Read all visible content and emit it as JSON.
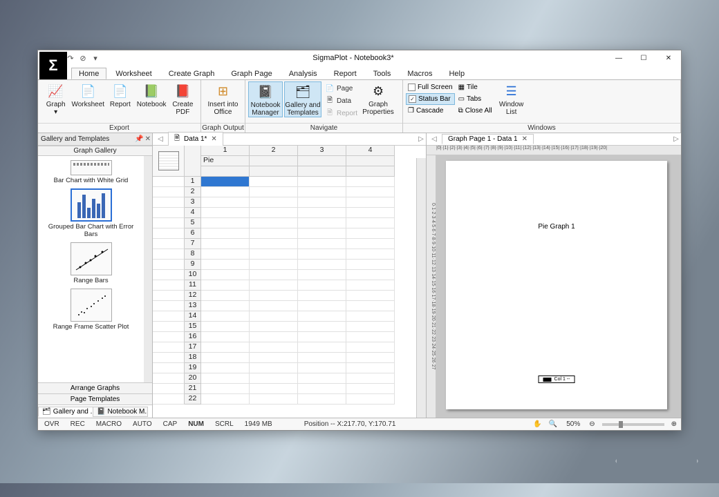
{
  "title": "SigmaPlot - Notebook3*",
  "qat": {
    "save": "💾",
    "undo": "↶",
    "redo": "↷",
    "cancel": "⊘"
  },
  "win": {
    "min": "—",
    "max": "☐",
    "close": "✕"
  },
  "menutabs": [
    "Home",
    "Worksheet",
    "Create Graph",
    "Graph Page",
    "Analysis",
    "Report",
    "Tools",
    "Macros",
    "Help"
  ],
  "active_tab": "Home",
  "ribbon": {
    "export": {
      "label": "Export",
      "graph": "Graph",
      "worksheet": "Worksheet",
      "report": "Report",
      "notebook": "Notebook",
      "create_pdf": "Create\nPDF"
    },
    "graph_output": {
      "label": "Graph Output",
      "insert_office": "Insert into\nOffice"
    },
    "navigate": {
      "label": "Navigate",
      "notebook_mgr": "Notebook\nManager",
      "gallery_tpl": "Gallery and\nTemplates",
      "page": "Page",
      "data": "Data",
      "report": "Report",
      "graph_props": "Graph\nProperties"
    },
    "windows": {
      "label": "Windows",
      "full_screen": "Full Screen",
      "status_bar": "Status Bar",
      "cascade": "Cascade",
      "tile": "Tile",
      "tabs": "Tabs",
      "close_all": "Close All",
      "window_list": "Window\nList"
    }
  },
  "leftpane": {
    "title": "Gallery and Templates",
    "sub": "Graph Gallery",
    "items": [
      {
        "label": "Bar Chart with White Grid"
      },
      {
        "label": "Grouped Bar Chart with Error Bars"
      },
      {
        "label": "Range Bars"
      },
      {
        "label": "Range Frame Scatter Plot"
      }
    ],
    "footer1": "Arrange Graphs",
    "footer2": "Page Templates",
    "bottom_tabs": {
      "a": "Gallery and ...",
      "b": "Notebook M..."
    }
  },
  "midpane": {
    "tab": "Data 1*",
    "cols": [
      "1",
      "2",
      "3",
      "4"
    ],
    "col1_header": "Pie",
    "rows": 22
  },
  "rightpane": {
    "tab": "Graph Page 1 - Data 1",
    "ruler_h": "|0|·|1|·|2|·|3|·|4|·|5|·|6|·|7|·|8|·|9|·|10|·|11|·|12|·|13|·|14|·|15|·|16|·|17|·|18|·|19|·|20|",
    "ruler_v": "0·1·2·3·4·5·6·7·8·9·10·11·12·13·14·15·16·17·18·19·20·21·22·23·24·25·26·27",
    "page_title": "Pie Graph 1",
    "legend": "Col 1 --"
  },
  "status": {
    "ovr": "OVR",
    "rec": "REC",
    "macro": "MACRO",
    "auto": "AUTO",
    "cap": "CAP",
    "num": "NUM",
    "scrl": "SCRL",
    "mem": "1949 MB",
    "pos": "Position -- X:217.70, Y:170.71",
    "zoom_pct": "50%",
    "zoom_minus": "⊖",
    "zoom_plus": "⊕",
    "hand": "✋",
    "mag": "🔍"
  }
}
